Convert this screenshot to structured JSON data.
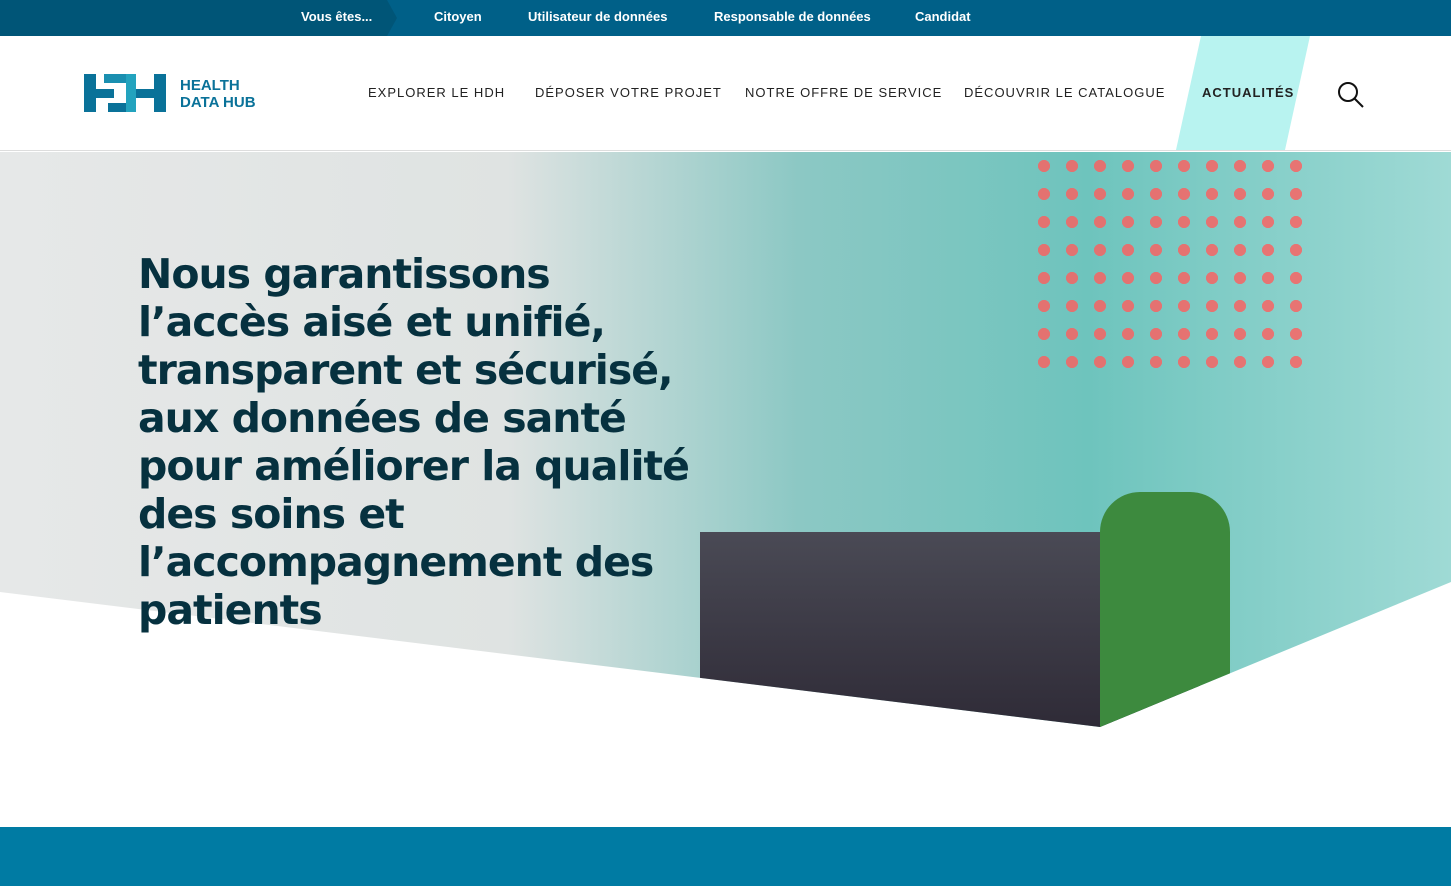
{
  "topbar": {
    "label": "Vous êtes...",
    "items": [
      "Citoyen",
      "Utilisateur de données",
      "Responsable de données",
      "Candidat"
    ]
  },
  "logo": {
    "line1": "HEALTH",
    "line2": "DATA HUB",
    "mark": "HDH"
  },
  "nav": {
    "items": [
      "EXPLORER LE HDH",
      "DÉPOSER VOTRE PROJET",
      "NOTRE OFFRE DE SERVICE",
      "DÉCOUVRIR LE CATALOGUE"
    ],
    "active": "ACTUALITÉS"
  },
  "hero": {
    "title": "Nous garantissons l’accès aisé et unifié, transparent et sécurisé, aux données de santé pour améliorer la qualité des soins et l’accompagnement des patients"
  }
}
